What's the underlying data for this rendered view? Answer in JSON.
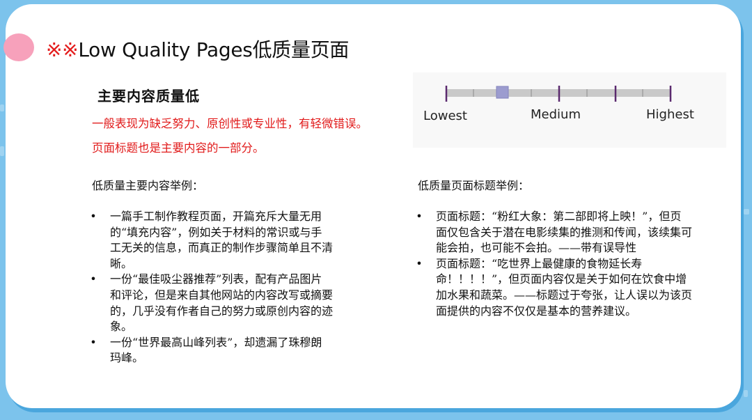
{
  "page": {
    "title_marks": "※※",
    "title_text": "Low Quality Pages低质量页面",
    "subhead": "主要内容质量低",
    "red_line_1": "一般表现为缺乏努力、原创性或专业性，有轻微错误。",
    "red_line_2": "页面标题也是主要内容的一部分。"
  },
  "scale": {
    "label_low": "Lowest",
    "label_mid": "Medium",
    "label_high": "Highest",
    "marker_level": 0.25,
    "colors": {
      "track": "#c9c9c9",
      "tick": "#5b2a6e",
      "marker": "#9c9ccf"
    }
  },
  "left_column": {
    "heading": "低质量主要内容举例：",
    "items": [
      "一篇手工制作教程页面，开篇充斥大量无用的“填充内容”，例如关于材料的常识或与手工无关的信息，而真正的制作步骤简单且不清晰。",
      "一份“最佳吸尘器推荐”列表，配有产品图片和评论，但是来自其他网站的内容改写或摘要的，几乎没有作者自己的努力或原创内容的迹象。",
      "一份“世界最高山峰列表”，却遗漏了珠穆朗玛峰。"
    ]
  },
  "right_column": {
    "heading": "低质量页面标题举例：",
    "items": [
      "页面标题：“粉红大象：第二部即将上映！”，但页面仅包含关于潜在电影续集的推测和传闻，该续集可能会拍，也可能不会拍。——带有误导性",
      "页面标题：“吃世界上最健康的食物延长寿命！！！！”，但页面内容仅是关于如何在饮食中增加水果和蔬菜。——标题过于夸张，让人误以为该页面提供的内容不仅仅是基本的营养建议。"
    ]
  },
  "bullet_char": "•",
  "colors": {
    "background": "#7cc3ec",
    "card": "#ffffff",
    "accent_red": "#e11b1b",
    "pink": "#f7a1bb"
  }
}
